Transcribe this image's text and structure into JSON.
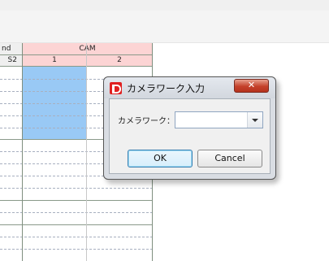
{
  "grid": {
    "header_partial_text": "nd",
    "group_header": "CAM",
    "sub_headers": [
      "S2",
      "1",
      "2"
    ]
  },
  "dialog": {
    "title": "カメラワーク入力",
    "close_glyph": "✕",
    "field_label": "カメラワーク：",
    "field_value": "",
    "ok_label": "OK",
    "cancel_label": "Cancel"
  },
  "colors": {
    "header_pink": "#fcd4d4",
    "selection_blue": "#99c9f5",
    "close_red": "#c4412b"
  },
  "icons": {
    "app_icon": "app-logo-icon",
    "dropdown": "chevron-down-icon",
    "close": "close-icon"
  }
}
